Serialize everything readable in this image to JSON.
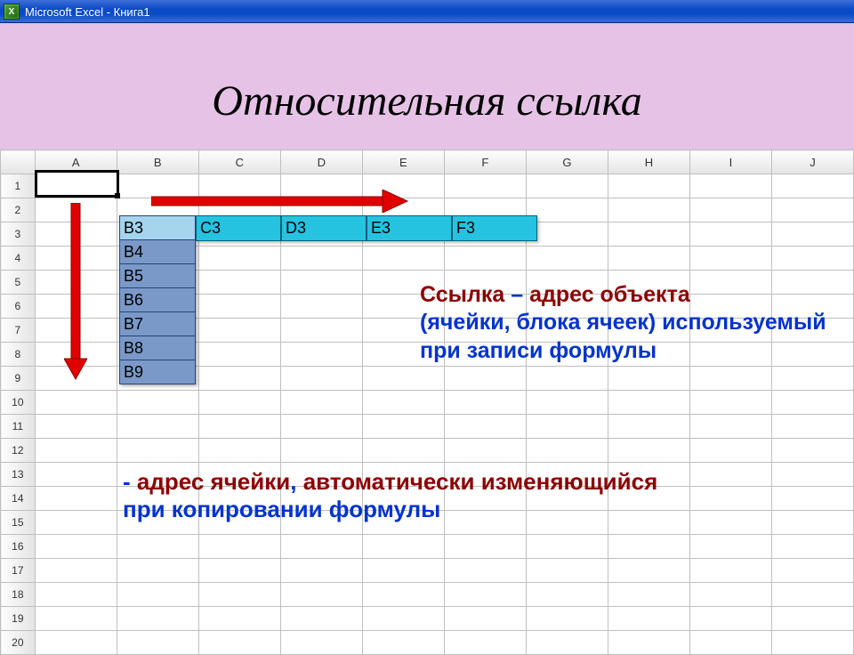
{
  "titlebar": {
    "app_title": "Microsoft Excel - Книга1",
    "icon_letter": "X"
  },
  "slide": {
    "title": "Относительная ссылка"
  },
  "columns": [
    "A",
    "B",
    "C",
    "D",
    "E",
    "F",
    "G",
    "H",
    "I",
    "J"
  ],
  "row_count": 20,
  "vertical_refs": [
    "B3",
    "B4",
    "B5",
    "B6",
    "B7",
    "B8",
    "B9"
  ],
  "horizontal_refs": [
    "C3",
    "D3",
    "E3",
    "F3"
  ],
  "text1": {
    "w1": "Ссылка",
    "dash": " – ",
    "w2": "адрес объекта",
    "rest": "(ячейки, блока ячеек) используемый при записи формулы"
  },
  "text2": {
    "dash": "- ",
    "w1": "адрес ячейки",
    "mid": ", ",
    "w2": "автоматически изменяющийся",
    "rest": " при копировании формулы"
  }
}
